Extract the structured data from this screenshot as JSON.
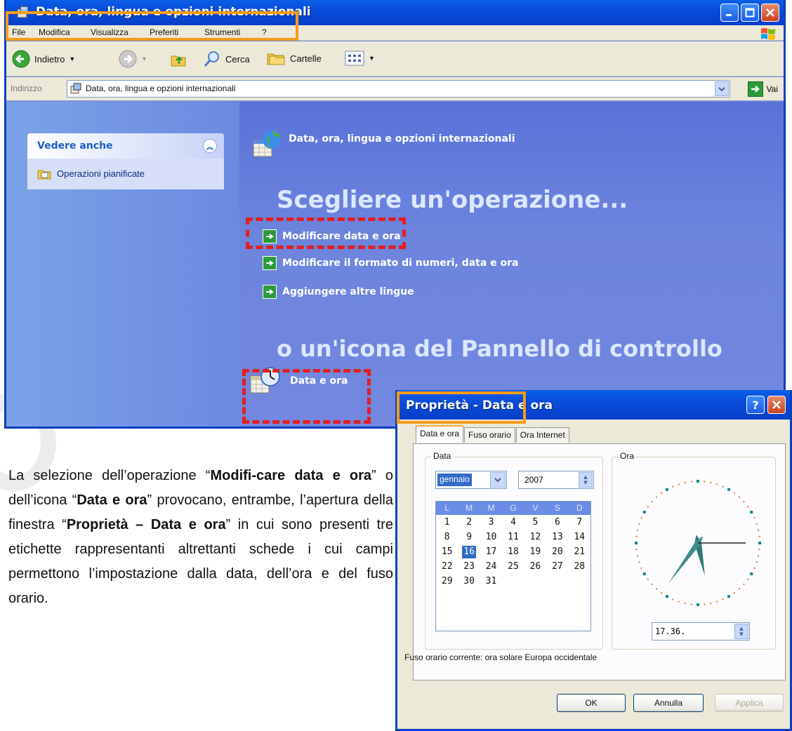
{
  "explorer": {
    "title": "Data, ora, lingua e opzioni internazionali",
    "menu": [
      "File",
      "Modifica",
      "Visualizza",
      "Preferiti",
      "Strumenti",
      "?"
    ],
    "toolbar": {
      "back": "Indietro",
      "search": "Cerca",
      "folders": "Cartelle"
    },
    "address": {
      "label": "Indirizzo",
      "value": "Data, ora, lingua e opzioni internazionali",
      "go": "Vai"
    },
    "sidebar": {
      "panel_title": "Vedere anche",
      "links": [
        "Operazioni pianificate"
      ]
    },
    "main": {
      "category_title": "Data, ora, lingua e opzioni internazionali",
      "task_heading": "Scegliere un'operazione...",
      "tasks": [
        "Modificare data e ora",
        "Modificare il formato di numeri, data e ora",
        "Aggiungere altre lingue"
      ],
      "icon_heading": "o un'icona del Pannello di controllo",
      "icons": [
        "Data e ora"
      ]
    }
  },
  "dialog": {
    "title": "Proprietà - Data e ora",
    "tabs": [
      "Data e ora",
      "Fuso orario",
      "Ora Internet"
    ],
    "date_group": "Data",
    "time_group": "Ora",
    "month": "gennaio",
    "year": "2007",
    "weekday_headers": [
      "L",
      "M",
      "M",
      "G",
      "V",
      "S",
      "D"
    ],
    "days": [
      "1",
      "2",
      "3",
      "4",
      "5",
      "6",
      "7",
      "8",
      "9",
      "10",
      "11",
      "12",
      "13",
      "14",
      "15",
      "16",
      "17",
      "18",
      "19",
      "20",
      "21",
      "22",
      "23",
      "24",
      "25",
      "26",
      "27",
      "28",
      "29",
      "30",
      "31"
    ],
    "selected_day": "16",
    "time": "17.36.",
    "timezone_text": "Fuso orario corrente:  ora solare Europa occidentale",
    "buttons": {
      "ok": "OK",
      "cancel": "Annulla",
      "apply": "Applica"
    }
  },
  "paragraph": {
    "t1": "La selezione dell’operazione “",
    "b1": "Modifi-care data e ora",
    "t2": "” o dell’icona “",
    "b2": "Data e ora",
    "t3": "” provocano, entrambe, l’apertura della finestra “",
    "b3": "Proprietà – Data e ora",
    "t4": "” in cui sono presenti tre etichette rappresentanti altrettanti schede i cui campi permettono l’impostazione dalla data, dell’ora e del fuso orario."
  },
  "colors": {
    "xp_blue": "#0a4ad8",
    "highlight_red": "#e21f1f",
    "highlight_orange": "#f39c1a",
    "task_bg": "#6e86e0"
  }
}
